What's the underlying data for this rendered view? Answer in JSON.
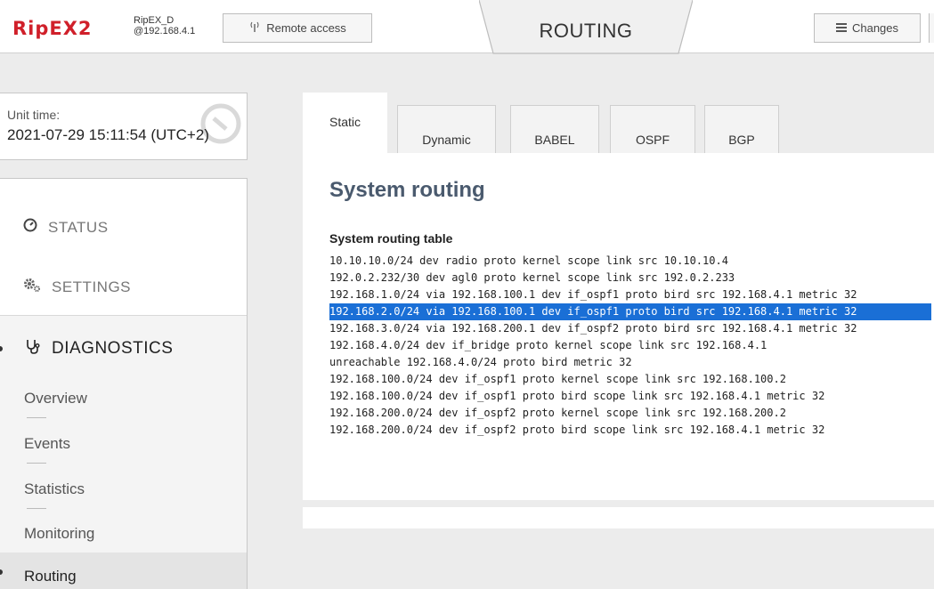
{
  "header": {
    "logo": "RipEX2",
    "device_name": "RipEX_D",
    "device_ip": "@192.168.4.1",
    "remote_access_label": "Remote access",
    "title": "ROUTING",
    "changes_label": "Changes"
  },
  "unit_time": {
    "label": "Unit time:",
    "value": "2021-07-29 15:11:54 (UTC+2)"
  },
  "sidebar": {
    "status_label": "STATUS",
    "settings_label": "SETTINGS",
    "diagnostics_label": "DIAGNOSTICS",
    "sub_items": [
      "Overview",
      "Events",
      "Statistics",
      "Monitoring",
      "Routing"
    ]
  },
  "tabs": [
    "Static",
    "Dynamic",
    "BABEL",
    "OSPF",
    "BGP"
  ],
  "active_tab": "Static",
  "main": {
    "title": "System routing",
    "table_title": "System routing table",
    "routes": [
      "10.10.10.0/24 dev radio proto kernel scope link src 10.10.10.4",
      "192.0.2.232/30 dev agl0 proto kernel scope link src 192.0.2.233",
      "192.168.1.0/24 via 192.168.100.1 dev if_ospf1 proto bird src 192.168.4.1 metric 32",
      "192.168.2.0/24 via 192.168.100.1 dev if_ospf1 proto bird src 192.168.4.1 metric 32",
      "192.168.3.0/24 via 192.168.200.1 dev if_ospf2 proto bird src 192.168.4.1 metric 32",
      "192.168.4.0/24 dev if_bridge proto kernel scope link src 192.168.4.1",
      "unreachable 192.168.4.0/24 proto bird metric 32",
      "192.168.100.0/24 dev if_ospf1 proto kernel scope link src 192.168.100.2",
      "192.168.100.0/24 dev if_ospf1 proto bird scope link src 192.168.4.1 metric 32",
      "192.168.200.0/24 dev if_ospf2 proto kernel scope link src 192.168.200.2",
      "192.168.200.0/24 dev if_ospf2 proto bird scope link src 192.168.4.1 metric 32"
    ],
    "selected_route_index": 3
  },
  "colors": {
    "brand_red": "#d0202a",
    "selection_blue": "#1a6fd6",
    "title_slate": "#4a5a6e"
  }
}
